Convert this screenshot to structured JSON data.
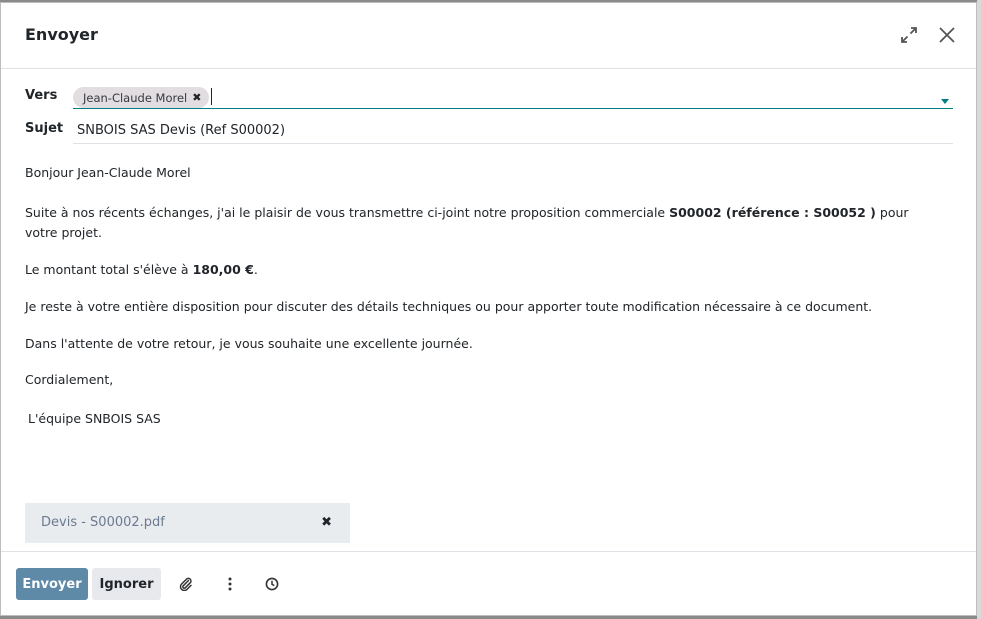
{
  "dialog": {
    "title": "Envoyer"
  },
  "fields": {
    "to_label": "Vers",
    "recipient_tag": "Jean-Claude Morel",
    "subject_label": "Sujet",
    "subject_value": "SNBOIS SAS Devis (Ref S00002)"
  },
  "body": {
    "greeting": "Bonjour Jean-Claude Morel",
    "intro_prefix": "Suite à nos récents échanges, j'ai le plaisir de vous transmettre ci-joint notre proposition commerciale ",
    "intro_bold": "S00002 (référence : S00052 )",
    "intro_suffix": " pour votre projet.",
    "amount_prefix": "Le montant total s'élève à ",
    "amount_bold": "180,00 €",
    "amount_suffix": ".",
    "availability": "Je reste à votre entière disposition pour discuter des détails techniques ou pour apporter toute modification nécessaire à ce document.",
    "closing_wish": "Dans l'attente de votre retour, je vous souhaite une excellente journée.",
    "regards": "Cordialement,",
    "signature": "L'équipe SNBOIS SAS"
  },
  "attachment": {
    "name": "Devis - S00002.pdf"
  },
  "footer": {
    "send_label": "Envoyer",
    "discard_label": "Ignorer"
  },
  "icons": {
    "expand": "expand-icon",
    "close": "close-icon",
    "tag_remove": "times-icon",
    "attachment_remove": "times-icon",
    "attach": "paperclip-icon",
    "more": "vertical-ellipsis-icon",
    "schedule": "clock-icon"
  },
  "colors": {
    "send_button": "#5e8aa8",
    "discard_button": "#e7e9ed",
    "tag_bg": "#e2dde0",
    "attachment_bg": "#e9ecef",
    "focus_underline": "#017e84"
  }
}
